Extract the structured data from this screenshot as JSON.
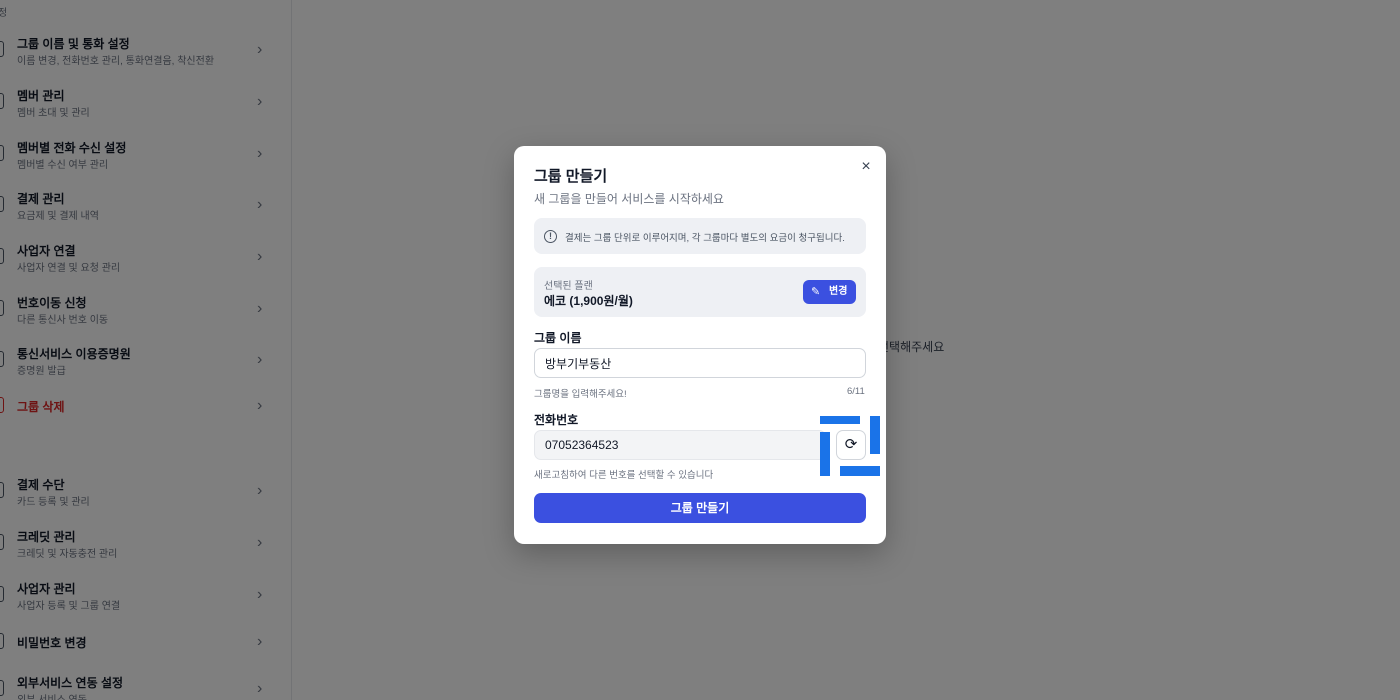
{
  "sidebar": {
    "section1_title": "정",
    "section2_title": "l",
    "items": [
      {
        "title": "그룹 이름 및 통화 설정",
        "sub": "이름 변경, 전화번호 관리, 통화연결음, 착신전환"
      },
      {
        "title": "멤버 관리",
        "sub": "멤버 초대 및 관리"
      },
      {
        "title": "멤버별 전화 수신 설정",
        "sub": "멤버별 수신 여부 관리"
      },
      {
        "title": "결제 관리",
        "sub": "요금제 및 결제 내역"
      },
      {
        "title": "사업자 연결",
        "sub": "사업자 연결 및 요청 관리"
      },
      {
        "title": "번호이동 신청",
        "sub": "다른 통신사 번호 이동"
      },
      {
        "title": "통신서비스 이용증명원",
        "sub": "증명원 발급"
      },
      {
        "title": "그룹 삭제",
        "sub": ""
      },
      {
        "title": "결제 수단",
        "sub": "카드 등록 및 관리"
      },
      {
        "title": "크레딧 관리",
        "sub": "크레딧 및 자동충전 관리"
      },
      {
        "title": "사업자 관리",
        "sub": "사업자 등록 및 그룹 연결"
      },
      {
        "title": "비밀번호 변경",
        "sub": ""
      },
      {
        "title": "외부서비스 연동 설정",
        "sub": "외부 서비스 연동"
      }
    ],
    "chevron": "›"
  },
  "main": {
    "hint": "선택해주세요"
  },
  "modal": {
    "title": "그룹 만들기",
    "subtitle": "새 그룹을 만들어 서비스를 시작하세요",
    "close_icon": "×",
    "notice": "결제는 그룹 단위로 이루어지며, 각 그룹마다 별도의 요금이 청구됩니다.",
    "notice_icon": "!",
    "plan": {
      "label": "선택된 플랜",
      "value": "에코 (1,900원/월)",
      "change_label": "변경",
      "change_icon": "✎"
    },
    "group_name": {
      "label": "그룹 이름",
      "value": "방부기부동산",
      "hint": "그룹명을 입력해주세요!",
      "counter": "6/11"
    },
    "phone": {
      "label": "전화번호",
      "value": "07052364523",
      "hint": "새로고침하여 다른 번호를 선택할 수 있습니다",
      "refresh_icon": "⟳"
    },
    "submit_label": "그룹 만들기"
  },
  "colors": {
    "primary": "#3b50e0",
    "danger": "#dc2626",
    "highlight": "#1a73e8"
  }
}
